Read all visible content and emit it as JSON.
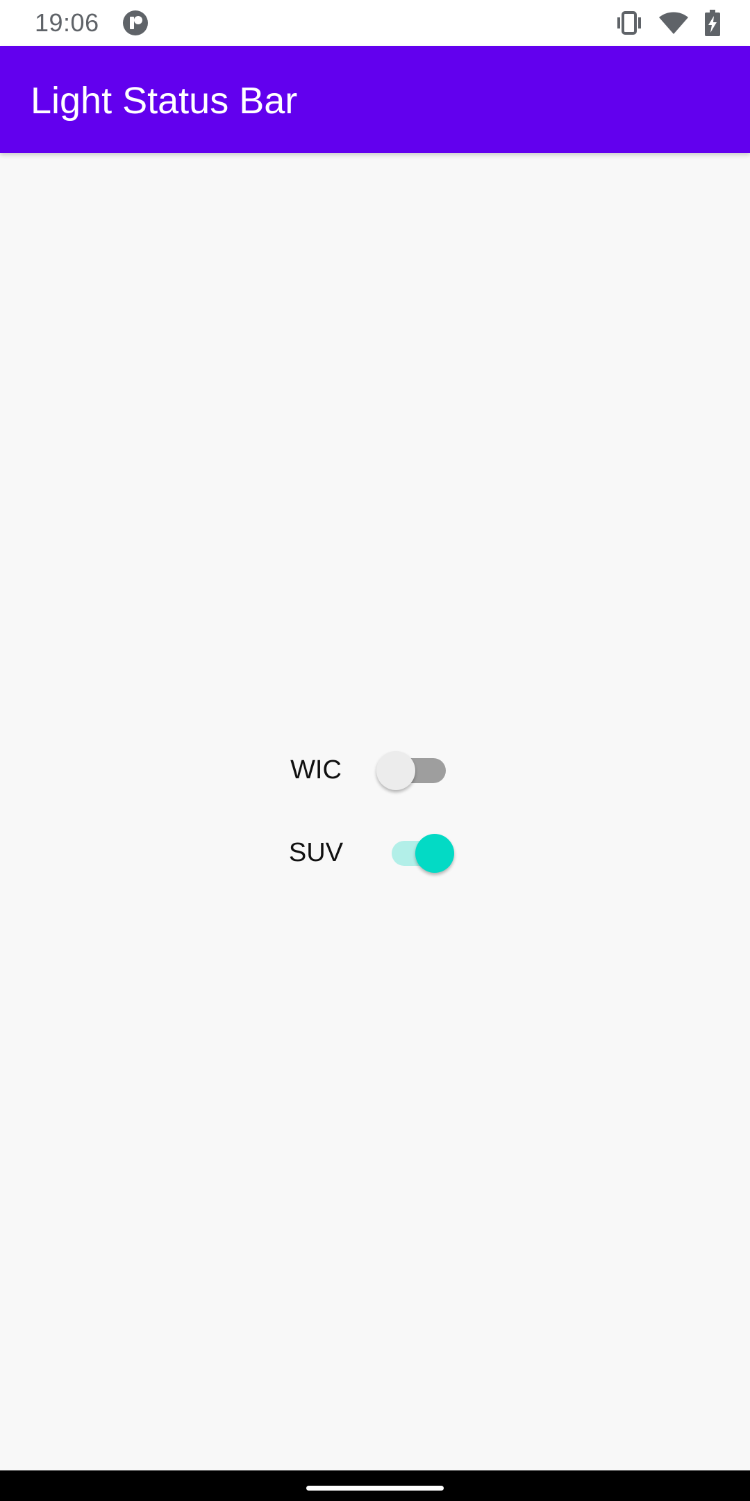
{
  "status_bar": {
    "time": "19:06",
    "icons": [
      "app-notification-icon",
      "vibrate-icon",
      "wifi-icon",
      "battery-charging-icon"
    ]
  },
  "app_bar": {
    "title": "Light Status Bar",
    "background_color": "#6200ee"
  },
  "switches": [
    {
      "label": "WIC",
      "checked": false
    },
    {
      "label": "SUV",
      "checked": true
    }
  ],
  "colors": {
    "switch_on_thumb": "#03dac5",
    "switch_on_track": "#b2efe8",
    "switch_off_thumb": "#ececec",
    "switch_off_track": "#9e9e9e"
  }
}
